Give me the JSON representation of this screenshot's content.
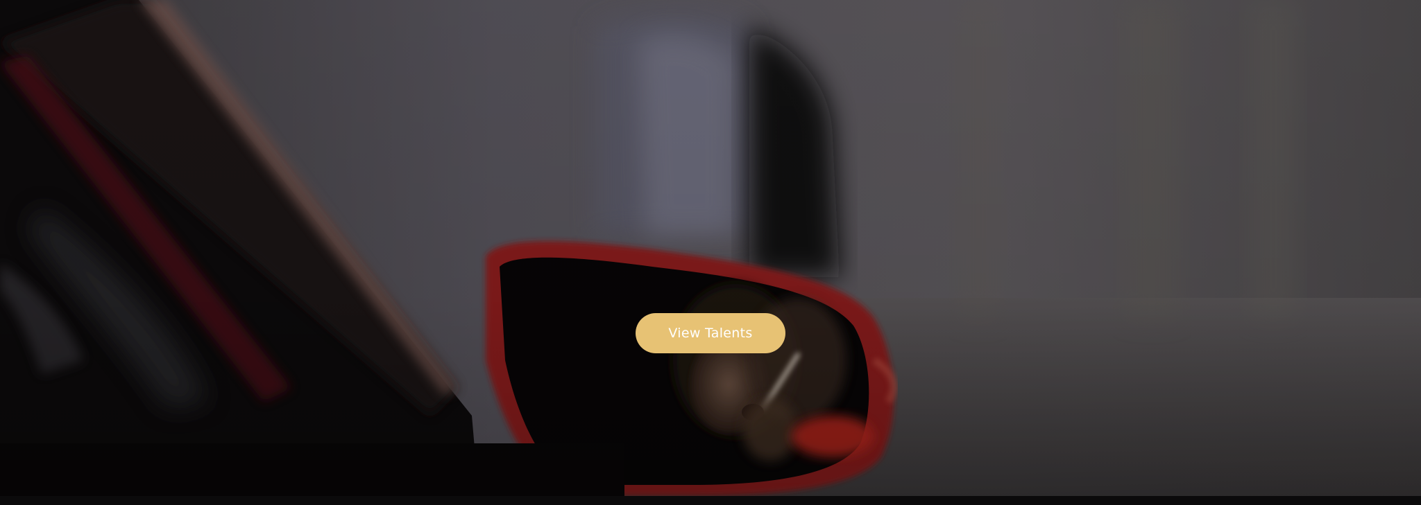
{
  "hero": {
    "background_description_icon": "video-still-background",
    "cta_label": "View Talents",
    "colors": {
      "cta_background": "#e7c274",
      "cta_text": "#ffffff"
    }
  }
}
